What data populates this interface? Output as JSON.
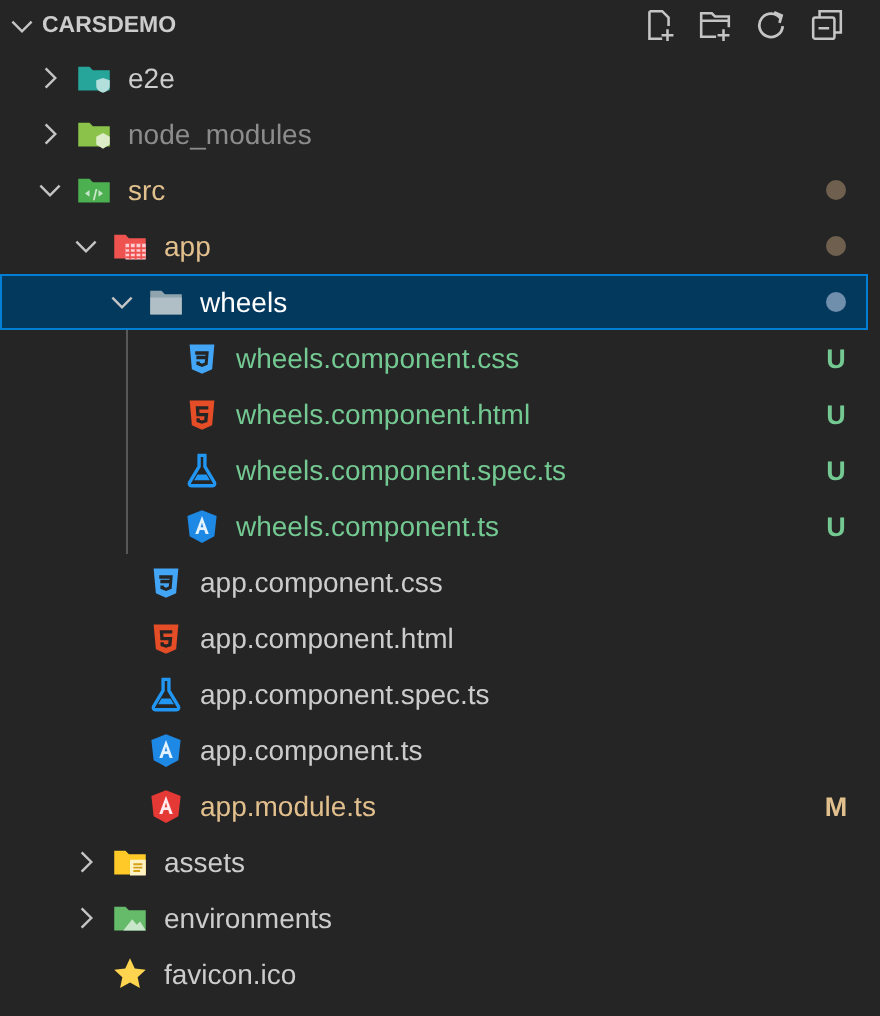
{
  "header": {
    "title": "CARSDEMO",
    "expanded": true
  },
  "tree": [
    {
      "name": "e2e",
      "kind": "testfolder",
      "expanded": false,
      "selected": false
    },
    {
      "name": "node_modules",
      "kind": "nodefolder",
      "expanded": false,
      "selected": false,
      "color": "#8c8c8c"
    },
    {
      "name": "src",
      "kind": "srcfolder",
      "expanded": true,
      "selected": false,
      "color": "#e2c08d",
      "changes": true,
      "children": [
        {
          "name": "app",
          "kind": "appfolder",
          "expanded": true,
          "selected": false,
          "color": "#e2c08d",
          "changes": true,
          "children": [
            {
              "name": "wheels",
              "kind": "folder",
              "expanded": true,
              "selected": true,
              "changes": true,
              "children": [
                {
                  "name": "wheels.component.css",
                  "kind": "css",
                  "selected": false,
                  "color": "#73c991",
                  "badge": "U"
                },
                {
                  "name": "wheels.component.html",
                  "kind": "html",
                  "selected": false,
                  "color": "#73c991",
                  "badge": "U"
                },
                {
                  "name": "wheels.component.spec.ts",
                  "kind": "spec",
                  "selected": false,
                  "color": "#73c991",
                  "badge": "U"
                },
                {
                  "name": "wheels.component.ts",
                  "kind": "component",
                  "selected": false,
                  "color": "#73c991",
                  "badge": "U"
                }
              ]
            },
            {
              "name": "app.component.css",
              "kind": "css",
              "selected": false
            },
            {
              "name": "app.component.html",
              "kind": "html",
              "selected": false
            },
            {
              "name": "app.component.spec.ts",
              "kind": "spec",
              "selected": false
            },
            {
              "name": "app.component.ts",
              "kind": "component",
              "selected": false
            },
            {
              "name": "app.module.ts",
              "kind": "module",
              "selected": false,
              "color": "#e2c08d",
              "badge": "M"
            }
          ]
        },
        {
          "name": "assets",
          "kind": "assetsfolder",
          "expanded": false,
          "selected": false
        },
        {
          "name": "environments",
          "kind": "envfolder",
          "expanded": false,
          "selected": false
        },
        {
          "name": "favicon.ico",
          "kind": "favicon",
          "selected": false
        }
      ]
    }
  ]
}
